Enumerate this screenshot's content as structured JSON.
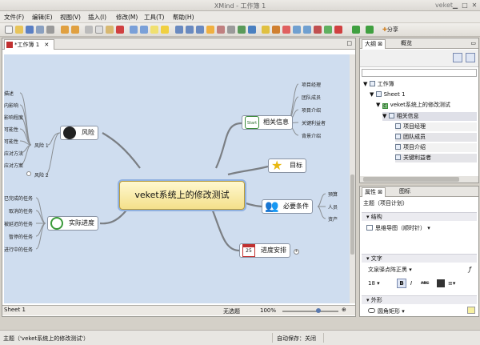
{
  "window": {
    "title": "XMind - 工作簿 1",
    "app": "veket"
  },
  "menu": [
    "文件(F)",
    "编辑(E)",
    "视图(V)",
    "插入(I)",
    "修改(M)",
    "工具(T)",
    "帮助(H)"
  ],
  "toolbar": {
    "share_label": "分享"
  },
  "editor": {
    "tab_label": "*工作簿 1",
    "sheet_tab": "Sheet 1",
    "node_status": "无选题",
    "zoom": "100%"
  },
  "map": {
    "central": "veket系统上的修改测试",
    "branches": {
      "related": {
        "label": "相关信息",
        "icon_text": "Start",
        "children": [
          "项目经理",
          "团队成员",
          "项目介绍",
          "关键利益者",
          "背景介绍"
        ]
      },
      "goal": {
        "label": "目标"
      },
      "conditions": {
        "label": "必要条件",
        "children": [
          "预算",
          "人员",
          "资产"
        ]
      },
      "schedule": {
        "label": "进度安排",
        "calendar_day": "25"
      },
      "progress": {
        "label": "实际进度",
        "children": [
          "已完成的任务",
          "取消的任务",
          "被延迟的任务",
          "暂停的任务",
          "进行中的任务"
        ]
      },
      "risk": {
        "label": "风险",
        "sub1": "风险 1",
        "sub2": "风险 2",
        "left_items": [
          "描述",
          "内影响",
          "影响程度",
          "可能性",
          "可能性",
          "应对方法",
          "应对方案"
        ]
      }
    }
  },
  "outline": {
    "tabs": [
      "大纲",
      "概览"
    ],
    "rows": [
      "工作簿",
      "Sheet 1",
      "veket系统上的修改测试",
      "相关信息",
      "项目经理",
      "团队成员",
      "项目介绍",
      "关键利益者"
    ],
    "row_prefix": "C"
  },
  "properties": {
    "tabs": [
      "属性",
      "图标"
    ],
    "header": "主题（项目计划）",
    "sections": [
      "结构",
      "文字",
      "外形",
      "线条"
    ],
    "structure_value": "思维导图（顺时针）",
    "font_name": "文泉驿点阵正黑",
    "font_size": "18",
    "bold": "B",
    "italic": "I",
    "strike": "ABC",
    "shape_value": "圆角矩形"
  },
  "status": {
    "topic": "主题（'veket系统上的修改测试'）",
    "autosave": "自动保存：关闭"
  },
  "colors": {
    "canvas": "#cfddef",
    "central_fill": "#f4e08a",
    "branch_line": "#7b7f84",
    "selection": "#8fb0e0"
  }
}
